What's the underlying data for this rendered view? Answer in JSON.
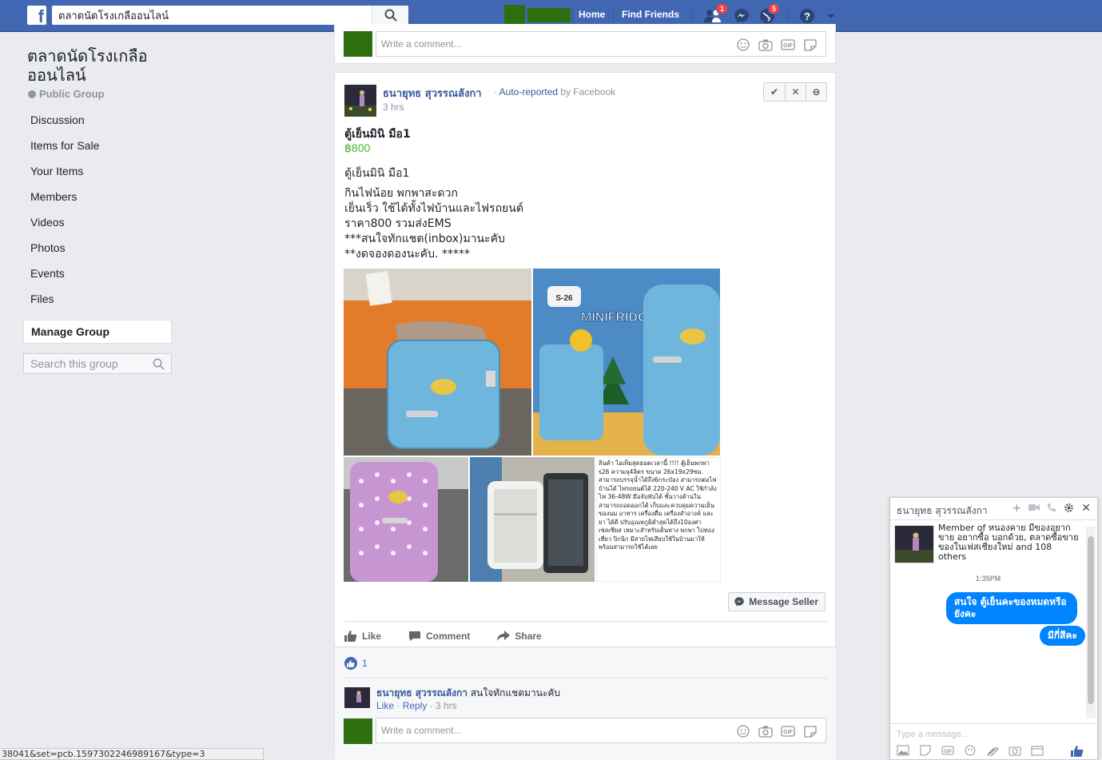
{
  "topbar": {
    "search_value": "ตลาดนัดโรงเกลืออนไลน์",
    "home": "Home",
    "find_friends": "Find Friends",
    "badge_friend_requests": "1",
    "badge_notifications": "5",
    "brand_color": "#4267b2"
  },
  "sidebar": {
    "group_name": "ตลาดนัดโรงเกลือ ออนไลน์",
    "group_type": "Public Group",
    "items": [
      {
        "label": "Discussion"
      },
      {
        "label": "Items for Sale"
      },
      {
        "label": "Your Items"
      },
      {
        "label": "Members"
      },
      {
        "label": "Videos"
      },
      {
        "label": "Photos"
      },
      {
        "label": "Events"
      },
      {
        "label": "Files"
      },
      {
        "label": "Manage Group"
      }
    ],
    "search_placeholder": "Search this group"
  },
  "top_comment": {
    "placeholder": "Write a comment..."
  },
  "post": {
    "author": "ธนายุทธ สุวรรณลังกา",
    "auto_reported_link": "Auto-reported",
    "auto_reported_by": "by Facebook",
    "time": "3 hrs",
    "moderate_approve": "✔",
    "moderate_remove": "✕",
    "moderate_block": "⊖",
    "item_title": "ตู้เย็นมินิ มือ1",
    "price": "฿800",
    "body_lines": [
      "ตู้เย็นมินิ มือ1",
      "",
      "กินไฟน้อย พกพาสะดวก",
      "เย็นเร็ว ใช้ได้ทั้งไฟบ้านและไฟรถยนต์",
      "ราคา800 รวมส่งEMS",
      "***สนใจทักแชต(inbox)มานะคับ",
      "**งดจองดองนะคับ. *****"
    ],
    "photo_text": "สินค้า ไอเท็มสุดฮอตเวลานี้ !!!! ตู้เย็นพกพา s26 ความจุ4ลิตร ขนาด 26x19x29ซม. สามารถบรรจุน้ำได้ถึง6กระป๋อง สามารถต่อไฟบ้านได้ ไฟรถยนต์ได้ 220-240 V AC ใช้กำลังไฟ 36-48W มือจับพับได้ ชั้นวางด้านในสามารถถอดออกได้ เก็บและควบคุมความเย็นของนม อาหาร เครื่องดื่ม เครื่องสำอางค์ และยา ได้ดี ปรับอุณหภูมิต่ำสุดได้ถึง10องศาเซลเซียส เหมาะสำหรับเดินทาง พกพา ไปท่องเที่ยว ปิกนิก มีสายไฟเสียบใช้ในบ้านมาให้พร้อมสามารถใช้ได้เลย",
    "message_seller": "Message Seller",
    "like": "Like",
    "comment": "Comment",
    "share": "Share",
    "like_count": "1",
    "reply": {
      "author": "ธนายุทธ สุวรรณลังกา",
      "text": "สนใจทักแชตมานะคับ",
      "like": "Like",
      "reply": "Reply",
      "time": "3 hrs"
    },
    "comment_placeholder": "Write a comment..."
  },
  "chat": {
    "name": "ธนายุทธ สุวรรณลังกา",
    "card_text": "Member of หนองคาย มีของอยากขาย อยากซื้อ บอกด้วย, ตลาดซื้อขายของในเฟสเชียงใหม่ and 108 others",
    "time": "1:35PM",
    "messages": [
      "สนใจ ตู้เย็นคะของหมดหรือยังคะ",
      "มีกี่สีคะ"
    ],
    "input_placeholder": "Type a message...",
    "bubble_color": "#0084ff"
  },
  "status_url": "38041&set=pcb.1597302246989167&type=3"
}
